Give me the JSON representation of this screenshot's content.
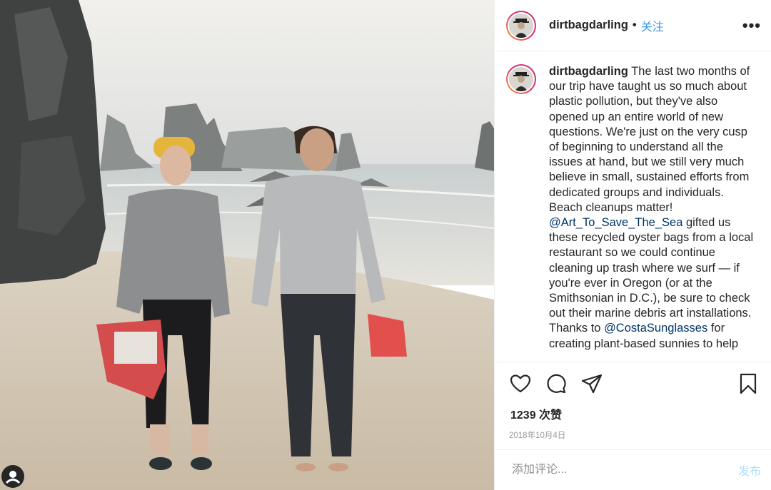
{
  "header": {
    "username": "dirtbagdarling",
    "separator": "•",
    "follow_label": "关注",
    "more_label": "•••"
  },
  "caption": {
    "username": "dirtbagdarling",
    "text_part1": "The last two months of our trip have taught us so much about plastic pollution, but they've also opened up an entire world of new questions. We're just on the very cusp of beginning to understand all the issues at hand, but we still very much believe in small, sustained efforts from dedicated groups and individuals. Beach cleanups matter!",
    "mention1": "@Art_To_Save_The_Sea",
    "text_part2": "gifted us these recycled oyster bags from a local restaurant so we could continue cleaning up trash where we surf — if you're ever in Oregon (or at the Smithsonian in D.C.), be sure to check out their marine debris art installations. Thanks to",
    "mention2": "@CostaSunglasses",
    "text_part3": "for creating plant-based sunnies to help"
  },
  "actions": {
    "icons": [
      "heart-icon",
      "comment-icon",
      "share-icon",
      "bookmark-icon"
    ]
  },
  "likes": "1239 次赞",
  "date": "2018年10月4日",
  "comment": {
    "placeholder": "添加评论...",
    "post_label": "发布"
  },
  "colors": {
    "accent": "#3897f0",
    "mention": "#003569",
    "post_disabled": "#b2dffc"
  }
}
